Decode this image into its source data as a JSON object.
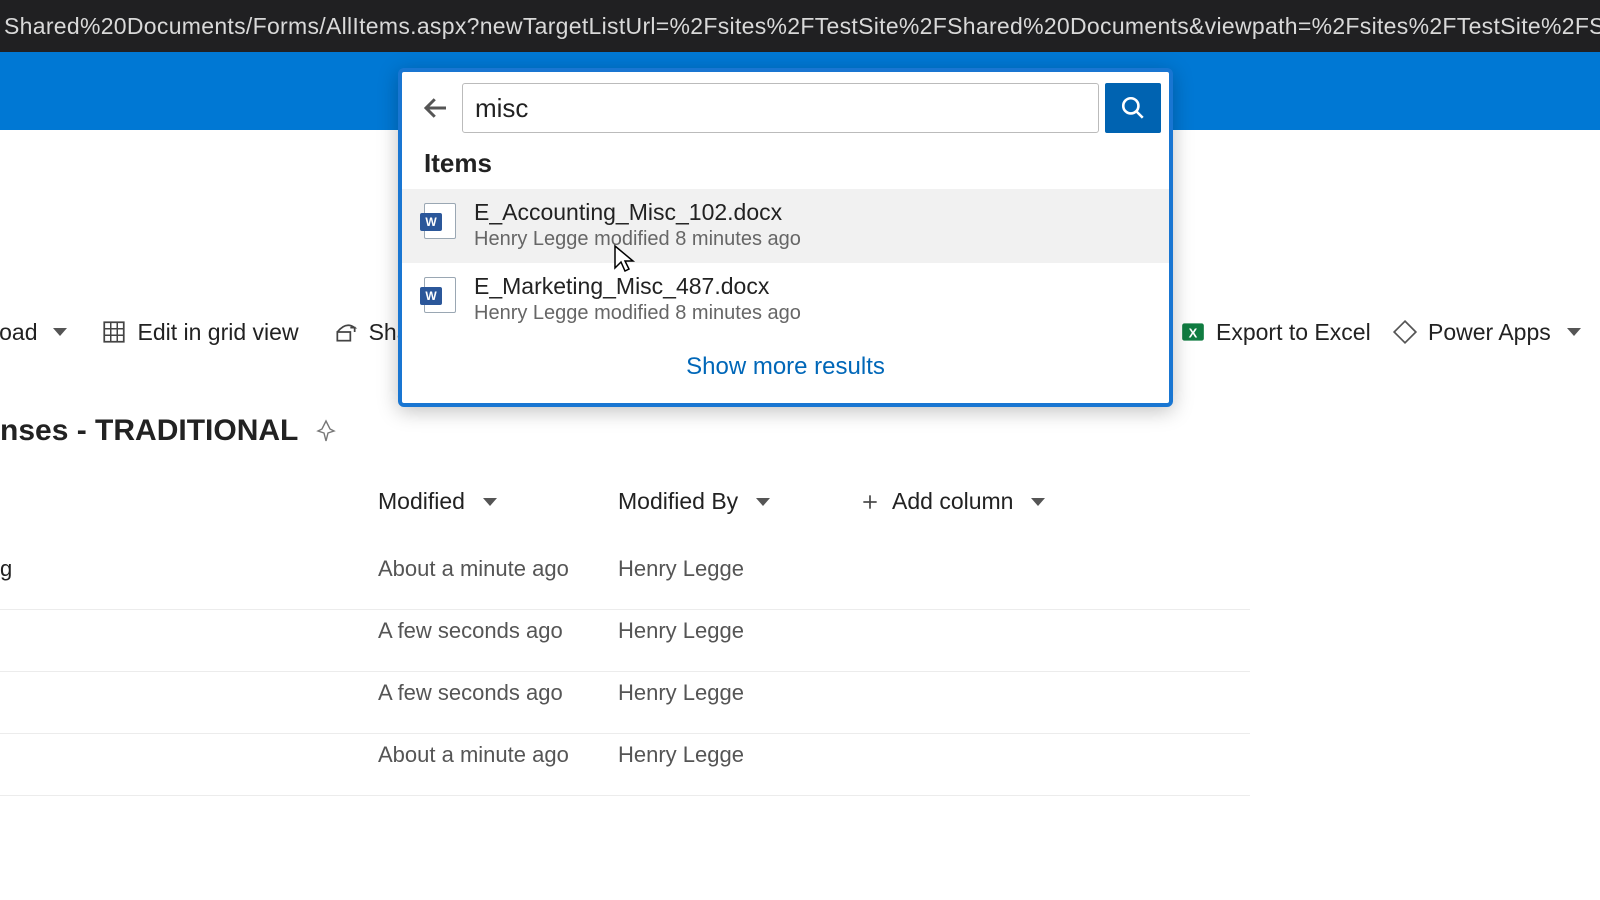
{
  "urlbar": "Shared%20Documents/Forms/AllItems.aspx?newTargetListUrl=%2Fsites%2FTestSite%2FShared%20Documents&viewpath=%2Fsites%2FTestSite%2FShared%20Docu",
  "commands": {
    "upload": "load",
    "edit_grid": "Edit in grid view",
    "share": "Share",
    "export_excel": "Export to Excel",
    "power_apps": "Power Apps"
  },
  "page_title": "nses - TRADITIONAL",
  "columns": {
    "modified": "Modified",
    "modified_by": "Modified By",
    "add_column": "Add column"
  },
  "rows": [
    {
      "name_stub": "g",
      "modified": "About a minute ago",
      "modified_by": "Henry Legge"
    },
    {
      "name_stub": "",
      "modified": "A few seconds ago",
      "modified_by": "Henry Legge"
    },
    {
      "name_stub": "",
      "modified": "A few seconds ago",
      "modified_by": "Henry Legge"
    },
    {
      "name_stub": "",
      "modified": "About a minute ago",
      "modified_by": "Henry Legge"
    }
  ],
  "search": {
    "query": "misc",
    "section_label": "Items",
    "show_more": "Show more results",
    "results": [
      {
        "title": "E_Accounting_Misc_102.docx",
        "meta": "Henry Legge modified 8 minutes ago"
      },
      {
        "title": "E_Marketing_Misc_487.docx",
        "meta": "Henry Legge modified 8 minutes ago"
      }
    ]
  }
}
